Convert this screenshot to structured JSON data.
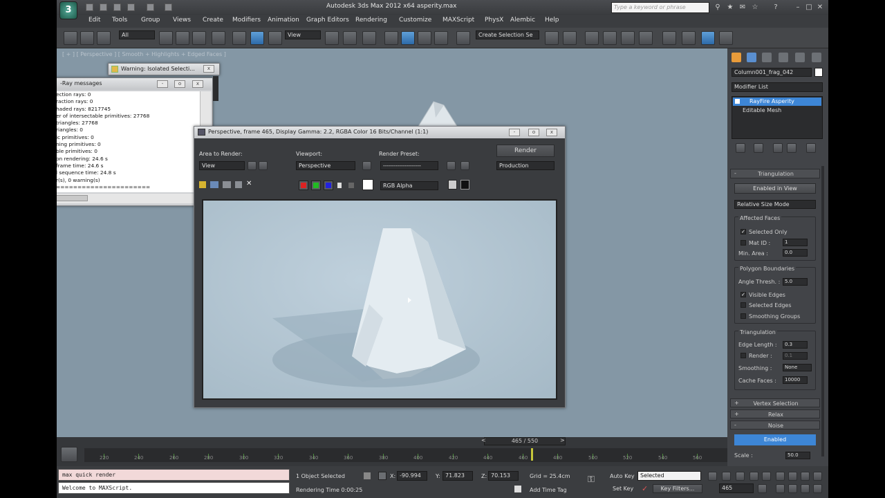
{
  "window": {
    "title": "Autodesk 3ds Max 2012 x64     asperity.max",
    "search_placeholder": "Type a keyword or phrase",
    "app_logo": "3ds-max-logo"
  },
  "menu": [
    "Edit",
    "Tools",
    "Group",
    "Views",
    "Create",
    "Modifiers",
    "Animation",
    "Graph Editors",
    "Rendering",
    "Customize",
    "MAXScript",
    "PhysX",
    "Alembic",
    "Help"
  ],
  "toolbar": {
    "filter_value": "All",
    "refcoord_value": "View",
    "selection_set": "Create Selection Se"
  },
  "viewport": {
    "label": "[ + ] [ Perspective ] [ Smooth + Highlights + Edged Faces ]"
  },
  "warning_window": {
    "title": "Warning: Isolated Selecti..."
  },
  "vray_messages": {
    "title": "-Ray messages",
    "lines": [
      "ection rays: 0",
      "raction rays: 0",
      "haded rays: 8217745",
      "er of intersectable primitives: 27768",
      "triangles: 27768",
      "riangles: 0",
      "ic primitives: 0",
      "ning primitives: 0",
      "ble primitives: 0",
      "on rendering: 24.6 s",
      "frame time: 24.6 s",
      "l sequence time: 24.8 s",
      "r(s), 0 warning(s)",
      "======================"
    ]
  },
  "render_frame": {
    "title": "Perspective, frame 465, Display Gamma: 2.2, RGBA Color 16 Bits/Channel (1:1)",
    "area_label": "Area to Render:",
    "area_value": "View",
    "viewport_label": "Viewport:",
    "viewport_value": "Perspective",
    "preset_label": "Render Preset:",
    "preset_value": "-------------------",
    "render_button": "Render",
    "production_value": "Production",
    "channel_value": "RGB Alpha"
  },
  "command_panel": {
    "object_name": "Column001_frag_042",
    "modifier_list": "Modifier List",
    "stack": [
      "RayFire Asperity",
      "Editable Mesh"
    ],
    "triangulation_title": "Triangulation",
    "enabled_in_view": "Enabled in View",
    "size_mode": "Relative Size Mode",
    "affected_faces": "Affected Faces",
    "selected_only": "Selected Only",
    "mat_id_label": "Mat ID :",
    "mat_id_value": "1",
    "min_area_label": "Min. Area :",
    "min_area_value": "0.0",
    "polygon_boundaries": "Polygon Boundaries",
    "angle_thresh_label": "Angle Thresh. :",
    "angle_thresh_value": "5.0",
    "visible_edges": "Visible Edges",
    "selected_edges": "Selected Edges",
    "smoothing_groups": "Smoothing Groups",
    "triangulation_sub": "Triangulation",
    "edge_length_label": "Edge Length :",
    "edge_length_value": "0.3",
    "render_label": "Render :",
    "render_value": "0.1",
    "smoothing_label": "Smoothing :",
    "smoothing_value": "None",
    "cache_faces_label": "Cache Faces :",
    "cache_faces_value": "10000",
    "vertex_selection": "Vertex Selection",
    "relax": "Relax",
    "noise": "Noise",
    "enabled_button": "Enabled",
    "scale_label": "Scale :",
    "scale_value": "50.0"
  },
  "timeline": {
    "slider_text": "465 / 550",
    "ticks": [
      "220",
      "240",
      "260",
      "280",
      "300",
      "320",
      "340",
      "360",
      "380",
      "400",
      "420",
      "440",
      "460",
      "480",
      "500",
      "520",
      "540",
      "560"
    ],
    "current_frame": 465
  },
  "status": {
    "maxscript_top": "max quick render",
    "maxscript_bottom": "Welcome to MAXScript.",
    "objects_selected": "1 Object Selected",
    "rendering_time": "Rendering Time  0:00:25",
    "x_label": "X:",
    "x_value": "-90.994",
    "y_label": "Y:",
    "y_value": "71.823",
    "z_label": "Z:",
    "z_value": "70.153",
    "grid": "Grid = 25.4cm",
    "add_time_tag": "Add Time Tag",
    "auto_key": "Auto Key",
    "selected_dd": "Selected",
    "set_key": "Set Key",
    "key_filters": "Key Filters...",
    "frame_field": "465"
  },
  "colors": {
    "accent_blue": "#3d86d6",
    "viewport_bg": "#8497a5",
    "render_bg": "#b4c6d2",
    "maxscript_pink": "#f2d9d9"
  }
}
